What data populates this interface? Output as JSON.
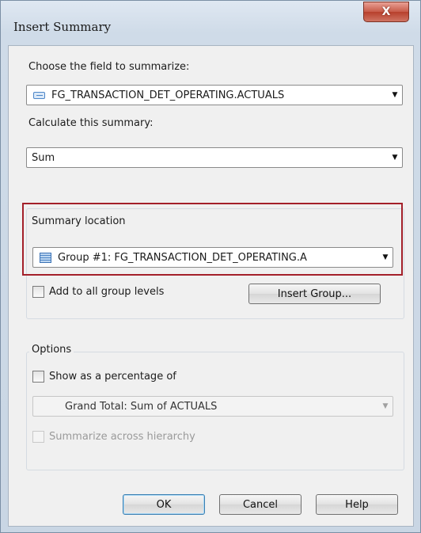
{
  "window": {
    "title": "Insert Summary",
    "close_label": "X"
  },
  "field": {
    "label": "Choose the field to summarize:",
    "value": "FG_TRANSACTION_DET_OPERATING.ACTUALS"
  },
  "calc": {
    "label": "Calculate this summary:",
    "value": "Sum"
  },
  "location": {
    "title": "Summary location",
    "value": "Group #1: FG_TRANSACTION_DET_OPERATING.A",
    "add_all_label": "Add to all group levels",
    "add_all_checked": false,
    "insert_group_label": "Insert Group..."
  },
  "options": {
    "title": "Options",
    "percentage_label": "Show as a percentage of",
    "percentage_checked": false,
    "percentage_value": "Grand Total: Sum of ACTUALS",
    "hierarchy_label": "Summarize across hierarchy",
    "hierarchy_checked": false
  },
  "buttons": {
    "ok": "OK",
    "cancel": "Cancel",
    "help": "Help"
  },
  "colors": {
    "highlight": "#a3202a",
    "close_button": "#c75a48"
  },
  "icons": {
    "field": "field-icon",
    "group": "group-icon",
    "dropdown": "chevron-down-icon",
    "close": "close-icon"
  }
}
